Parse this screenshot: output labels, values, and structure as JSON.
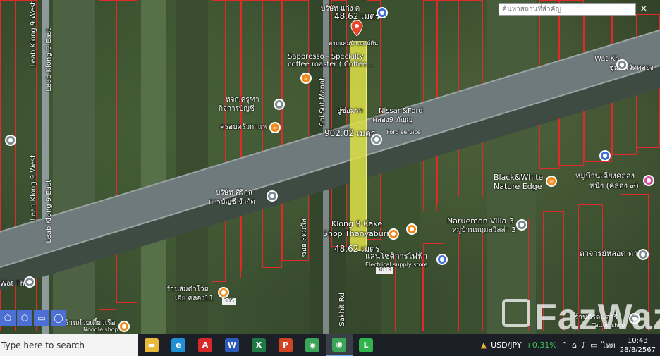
{
  "search": {
    "placeholder": "ค้นหาสถานที่สำคัญ",
    "close": "×"
  },
  "measurements": {
    "top": "48.62 เมตร",
    "middle": "902.02 เมตร",
    "bottom": "48.62 เมตร"
  },
  "roads": {
    "road_305_a": "305",
    "road_305_b": "305",
    "road_3019": "3019",
    "leab_klong9_west_a": "Leab Klong 9 West",
    "leab_klong9_east_a": "Leab Klong 9 East",
    "leab_klong9_west_b": "Leab Klong 9 West",
    "leab_klong9_east_b": "Leab Klong 9 East",
    "soi_sut_manat": "Soi Sut Manat",
    "soi_sut_manat_2": "ซอย สุดมนัส",
    "soi_khlong9": "Sakhit Rd"
  },
  "places": {
    "top_label": "บริษัท แก่ง ค",
    "sappresso": "Sappresso - Specialty coffee roaster ( Coffee...",
    "sappresso_th": "ตามแคมป์ แมคห์ดิน",
    "hok_kong": "หจก.ครุฑา",
    "hok_kong_2": "กิจการบัญชี",
    "krua": "ครอบครัวกาแฟ",
    "nissan": "Nissan&Ford",
    "auto_th": "อู่ซ่อมรถ",
    "auto_th2": "คลอง9 ภัญญ",
    "auto_sub": "Ford service",
    "company": "บริษัท ศิริกุล",
    "company_2": "การบัญชี จำกัด",
    "wat": "Wat Kh",
    "wat_th": "ชุมชนวัดคลอง",
    "black_white": "Black&White",
    "nature_edge": "Nature Edge",
    "village_th": "หมู่บ้านเดียงคลอง",
    "village_th2": "หนึ่ง (คลอง ๙)",
    "klong9_cake": "Klong 9 Cake",
    "klong9_cake_2": "Shop Thanyaburi",
    "naruemon": "Naruemon Villa 3",
    "naruemon_th": "หมู่บ้านนฤมลวิลล่า 3",
    "electrical_th": "แสนโชติการไฟฟ้า",
    "electrical": "Electrical supply store",
    "temple_right": "ถาจารย์หลอด ตาทิพ",
    "somtam": "ร้านส้มตำโว้ย",
    "somtam_2": "เฮีย คลอง11",
    "noodle_th": "ร้านก๋วยเตี๋ยวเรือ",
    "noodle": "Noodle shop",
    "eatery_right": "ร้านตีรัตน์ตอรี่",
    "eatery_right_2": "Tattoo shop",
    "left_small": "Wat Tha"
  },
  "tools": [
    "⬠",
    "⬡",
    "▭",
    "◯"
  ],
  "watermark": "FazWaz",
  "taskbar": {
    "search_placeholder": "Type here to search",
    "apps": [
      {
        "name": "file-explorer",
        "color": "#e8b93a",
        "glyph": "▬"
      },
      {
        "name": "edge",
        "color": "#1f8fd6",
        "glyph": "e"
      },
      {
        "name": "acrobat",
        "color": "#d7292a",
        "glyph": "A"
      },
      {
        "name": "word",
        "color": "#2b5bb8",
        "glyph": "W"
      },
      {
        "name": "excel",
        "color": "#1e7a45",
        "glyph": "X"
      },
      {
        "name": "powerpoint",
        "color": "#d04423",
        "glyph": "P"
      },
      {
        "name": "chrome",
        "color": "#3aa457",
        "glyph": "◉"
      },
      {
        "name": "chrome-2",
        "color": "#3aa457",
        "glyph": "◉"
      },
      {
        "name": "line",
        "color": "#2fb34a",
        "glyph": "L"
      }
    ],
    "ticker": "USD/JPY",
    "ticker_change": "+0.31%",
    "lang": "ไทย",
    "time": "10:43",
    "date": "28/8/2567"
  }
}
